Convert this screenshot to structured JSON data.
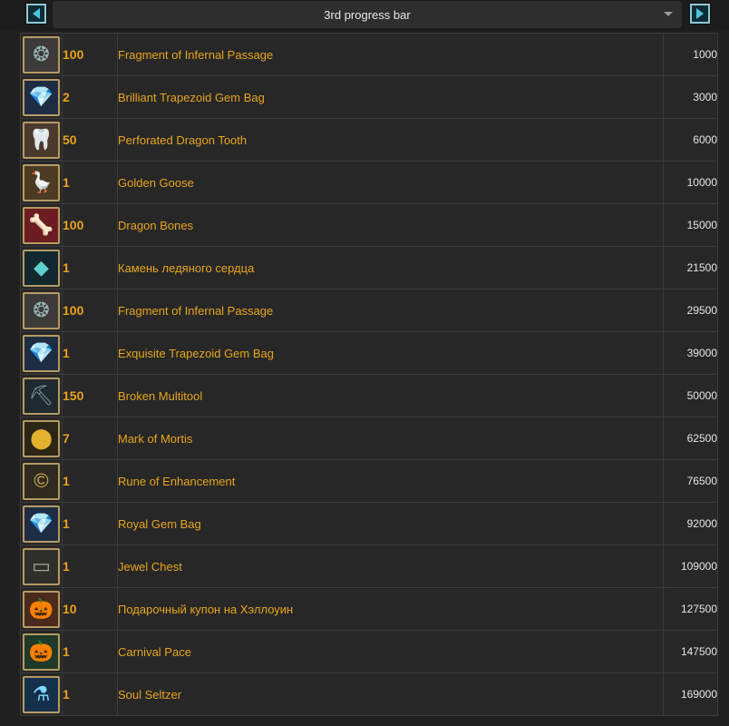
{
  "header": {
    "title": "3rd progress bar"
  },
  "rewards": [
    {
      "qty": "100",
      "name": "Fragment of Infernal Passage",
      "price": "1000",
      "icon": "infernal-fragment-icon",
      "glyph": "❂",
      "bg": "#3d3b39",
      "color": "#9ab7b6"
    },
    {
      "qty": "2",
      "name": "Brilliant Trapezoid Gem Bag",
      "price": "3000",
      "icon": "gem-bag-icon",
      "glyph": "💎",
      "bg": "#1e2c44",
      "color": "#8fb4ff"
    },
    {
      "qty": "50",
      "name": "Perforated Dragon Tooth",
      "price": "6000",
      "icon": "dragon-tooth-icon",
      "glyph": "🦷",
      "bg": "#4a3a2e",
      "color": "#e8d7b5"
    },
    {
      "qty": "1",
      "name": "Golden Goose",
      "price": "10000",
      "icon": "golden-goose-icon",
      "glyph": "🪿",
      "bg": "#4b3b22",
      "color": "#e0b341"
    },
    {
      "qty": "100",
      "name": "Dragon Bones",
      "price": "15000",
      "icon": "dragon-bones-icon",
      "glyph": "🦴",
      "bg": "#6b1d22",
      "color": "#e8e0d0"
    },
    {
      "qty": "1",
      "name": "Камень ледяного сердца",
      "price": "21500",
      "icon": "ice-heart-stone-icon",
      "glyph": "◆",
      "bg": "#12272e",
      "color": "#5fd0d0"
    },
    {
      "qty": "100",
      "name": "Fragment of Infernal Passage",
      "price": "29500",
      "icon": "infernal-fragment-icon",
      "glyph": "❂",
      "bg": "#3d3b39",
      "color": "#9ab7b6"
    },
    {
      "qty": "1",
      "name": "Exquisite Trapezoid Gem Bag",
      "price": "39000",
      "icon": "gem-bag-icon",
      "glyph": "💎",
      "bg": "#1e2c44",
      "color": "#8fb4ff"
    },
    {
      "qty": "150",
      "name": "Broken Multitool",
      "price": "50000",
      "icon": "multitool-icon",
      "glyph": "⛏",
      "bg": "#1f2a2e",
      "color": "#8aa0a6"
    },
    {
      "qty": "7",
      "name": "Mark of Mortis",
      "price": "62500",
      "icon": "mark-of-mortis-icon",
      "glyph": "⬤",
      "bg": "#2b2616",
      "color": "#e2b12e"
    },
    {
      "qty": "1",
      "name": "Rune of Enhancement",
      "price": "76500",
      "icon": "rune-icon",
      "glyph": "©",
      "bg": "#2e2a1f",
      "color": "#d9b25c"
    },
    {
      "qty": "1",
      "name": "Royal Gem Bag",
      "price": "92000",
      "icon": "gem-bag-icon",
      "glyph": "💎",
      "bg": "#1e2c44",
      "color": "#8fb4ff"
    },
    {
      "qty": "1",
      "name": "Jewel Chest",
      "price": "109000",
      "icon": "jewel-chest-icon",
      "glyph": "▭",
      "bg": "#2e2e2a",
      "color": "#a8a89a"
    },
    {
      "qty": "10",
      "name": "Подарочный купон на Хэллоуин",
      "price": "127500",
      "icon": "halloween-coupon-icon",
      "glyph": "🎃",
      "bg": "#4a2a1c",
      "color": "#f08a2a"
    },
    {
      "qty": "1",
      "name": "Carnival Pace",
      "price": "147500",
      "icon": "carnival-pace-icon",
      "glyph": "🎃",
      "bg": "#1f3a2a",
      "color": "#f0b030"
    },
    {
      "qty": "1",
      "name": "Soul Seltzer",
      "price": "169000",
      "icon": "soul-seltzer-icon",
      "glyph": "⚗",
      "bg": "#14304a",
      "color": "#7fd8ff"
    }
  ]
}
